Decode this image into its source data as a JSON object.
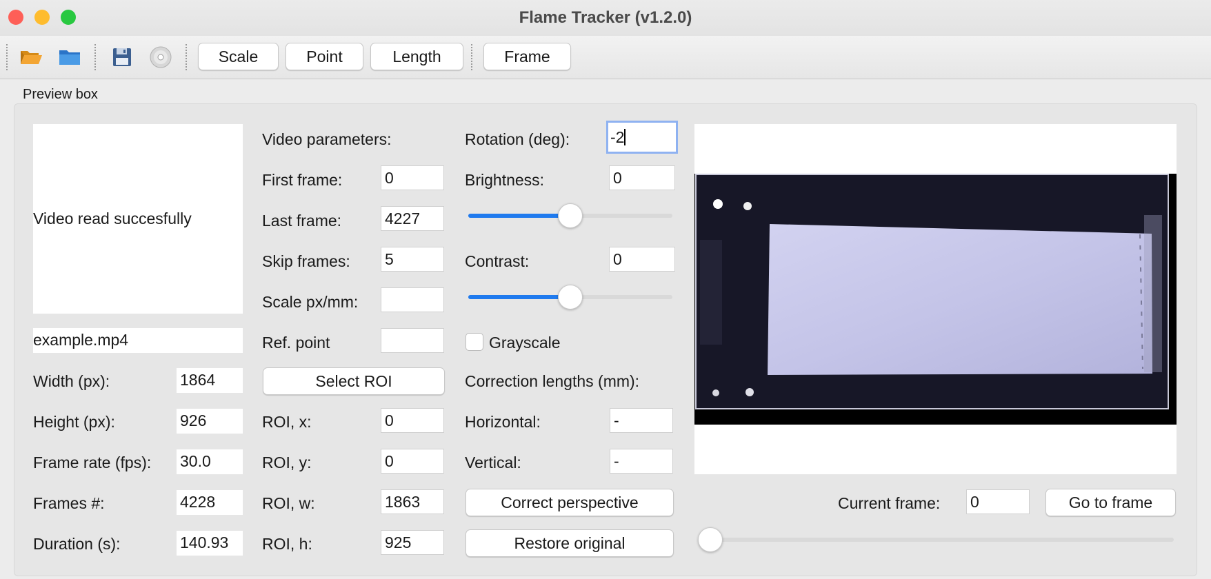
{
  "window": {
    "title": "Flame Tracker (v1.2.0)",
    "traffic_lights": {
      "close": "#fe5f57",
      "minimize": "#febc2e",
      "zoom": "#28c840"
    }
  },
  "toolbar": {
    "icons": [
      "open-folder-icon",
      "folder-icon",
      "save-icon",
      "disc-icon"
    ],
    "buttons": [
      "Scale",
      "Point",
      "Length",
      "Frame"
    ]
  },
  "preview": {
    "group_label": "Preview box",
    "status_text": "Video read succesfully",
    "filename": "example.mp4",
    "info": [
      {
        "label": "Width (px):",
        "value": "1864"
      },
      {
        "label": "Height (px):",
        "value": "926"
      },
      {
        "label": "Frame rate (fps):",
        "value": "30.0"
      },
      {
        "label": "Frames #:",
        "value": "4228"
      },
      {
        "label": "Duration (s):",
        "value": "140.93"
      }
    ],
    "video_params": {
      "header": "Video parameters:",
      "first_frame_label": "First frame:",
      "first_frame": "0",
      "last_frame_label": "Last frame:",
      "last_frame": "4227",
      "skip_frames_label": "Skip frames:",
      "skip_frames": "5",
      "scale_label": "Scale px/mm:",
      "scale": "",
      "ref_point_label": "Ref. point",
      "ref_point": "",
      "select_roi": "Select ROI",
      "roi_x_label": "ROI, x:",
      "roi_x": "0",
      "roi_y_label": "ROI, y:",
      "roi_y": "0",
      "roi_w_label": "ROI, w:",
      "roi_w": "1863",
      "roi_h_label": "ROI, h:",
      "roi_h": "925"
    },
    "adjust": {
      "rotation_label": "Rotation (deg):",
      "rotation": "-2",
      "brightness_label": "Brightness:",
      "brightness": "0",
      "brightness_slider": 0.5,
      "contrast_label": "Contrast:",
      "contrast": "0",
      "contrast_slider": 0.5,
      "grayscale_label": "Grayscale",
      "grayscale_checked": false,
      "correction_header": "Correction lengths (mm):",
      "horizontal_label": "Horizontal:",
      "horizontal": "-",
      "vertical_label": "Vertical:",
      "vertical": "-",
      "correct_perspective": "Correct perspective",
      "restore_original": "Restore original"
    },
    "navigation": {
      "current_frame_label": "Current frame:",
      "current_frame": "0",
      "go_to_frame": "Go to frame",
      "frame_slider": 0.0
    },
    "accent_color": "#1f7aee"
  }
}
